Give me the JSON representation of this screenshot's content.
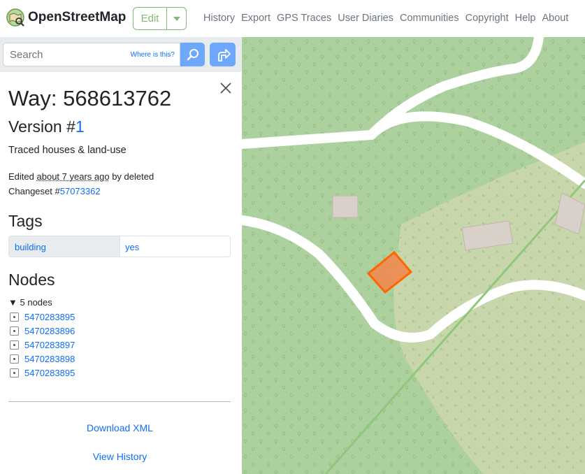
{
  "header": {
    "brand": "OpenStreetMap",
    "edit_label": "Edit",
    "nav": [
      "History",
      "Export",
      "GPS Traces",
      "User Diaries",
      "Communities",
      "Copyright",
      "Help",
      "About"
    ]
  },
  "search": {
    "placeholder": "Search",
    "where_link": "Where is this?"
  },
  "feature": {
    "title": "Way: 568613762",
    "version_prefix": "Version #",
    "version_number": "1",
    "comment": "Traced houses & land-use",
    "edited_prefix": "Edited",
    "edited_ago": "about 7 years ago",
    "edited_by": "by deleted",
    "changeset_prefix": "Changeset #",
    "changeset_id": "57073362"
  },
  "tags": {
    "heading": "Tags",
    "rows": [
      {
        "key": "building",
        "value": "yes"
      }
    ]
  },
  "nodes": {
    "heading": "Nodes",
    "summary": "5 nodes",
    "items": [
      "5470283895",
      "5470283896",
      "5470283897",
      "5470283898",
      "5470283895"
    ]
  },
  "actions": {
    "download": "Download XML",
    "history": "View History"
  },
  "colors": {
    "accent": "#7ebc6f",
    "link": "#0d6efd",
    "highlight": "#ff6600",
    "forest": "#add19e",
    "scrub": "#c8d7ab",
    "road": "#ffffff",
    "building": "#d9d0c9"
  }
}
